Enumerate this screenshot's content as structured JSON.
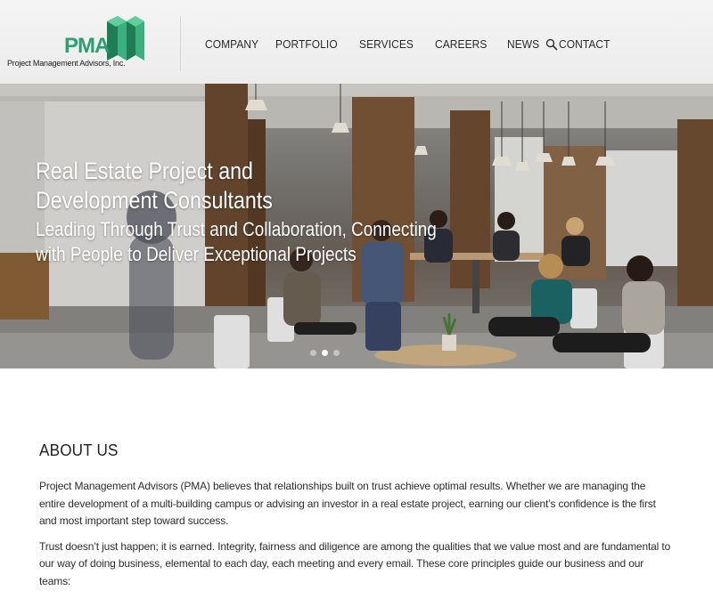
{
  "brand": {
    "logo_text": "PMA",
    "tagline": "Project Management Advisors, Inc.",
    "accent": "#2e9e6e",
    "accent_dark": "#1f7d56"
  },
  "nav": {
    "items": [
      {
        "label": "COMPANY"
      },
      {
        "label": "PORTFOLIO"
      },
      {
        "label": "SERVICES"
      },
      {
        "label": "CAREERS"
      },
      {
        "label": "NEWS"
      },
      {
        "label": "CONTACT"
      }
    ],
    "search_icon": "search-icon"
  },
  "hero": {
    "title_line1": "Real Estate Project and",
    "title_line2": "Development Consultants",
    "subtitle_line1": "Leading Through Trust and Collaboration, Connecting",
    "subtitle_line2": "with People to Deliver Exceptional Projects",
    "slides": 3,
    "active_slide": 1
  },
  "about": {
    "heading": "ABOUT US",
    "p1": "Project Management Advisors (PMA) believes that relationships built on trust achieve optimal results. Whether we are managing the entire development of a multi-building campus or advising an investor in a real estate project, earning our client’s confidence is the first and most important step toward success.",
    "p2": "Trust doesn’t just happen; it is earned. Integrity, fairness and diligence are among the qualities that we value most and are fundamental to our way of doing business, elemental to each day, each meeting and every email. These core principles guide our business and our teams:"
  }
}
